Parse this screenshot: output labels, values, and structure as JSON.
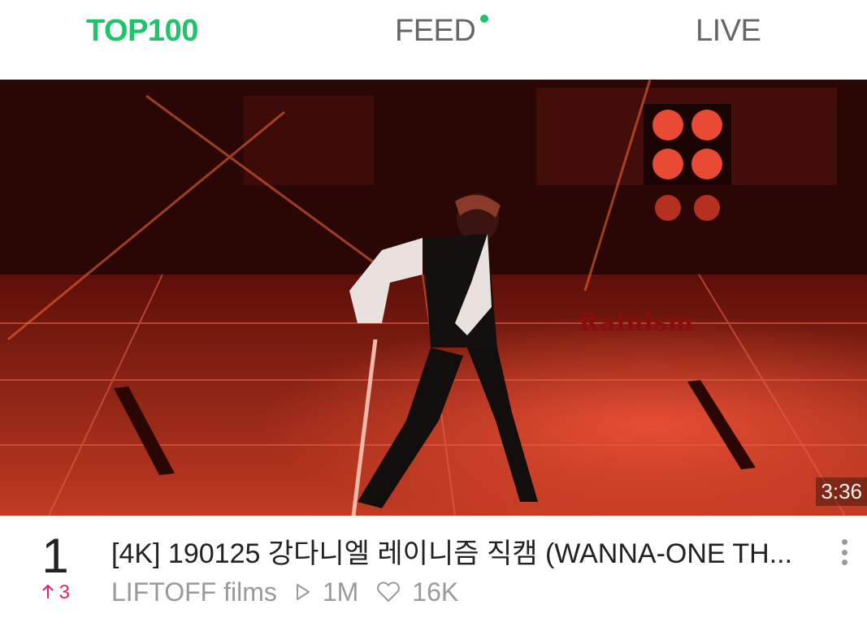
{
  "tabs": [
    {
      "label": "TOP100",
      "active": true
    },
    {
      "label": "FEED",
      "active": false,
      "has_new_dot": true
    },
    {
      "label": "LIVE",
      "active": false
    }
  ],
  "video": {
    "watermark": "Rainism",
    "duration": "3:36"
  },
  "item": {
    "rank": "1",
    "rank_change": "3",
    "rank_change_direction": "up",
    "title": "[4K] 190125 강다니엘 레이니즘 직캠 (WANNA-ONE TH...",
    "channel": "LIFTOFF films",
    "views": "1M",
    "likes": "16K"
  },
  "colors": {
    "accent": "#1ec46a",
    "rank_up": "#e0245e",
    "muted": "#9a9a9a"
  },
  "icons": [
    "play-icon",
    "heart-icon",
    "more-vertical-icon",
    "arrow-up-icon"
  ]
}
